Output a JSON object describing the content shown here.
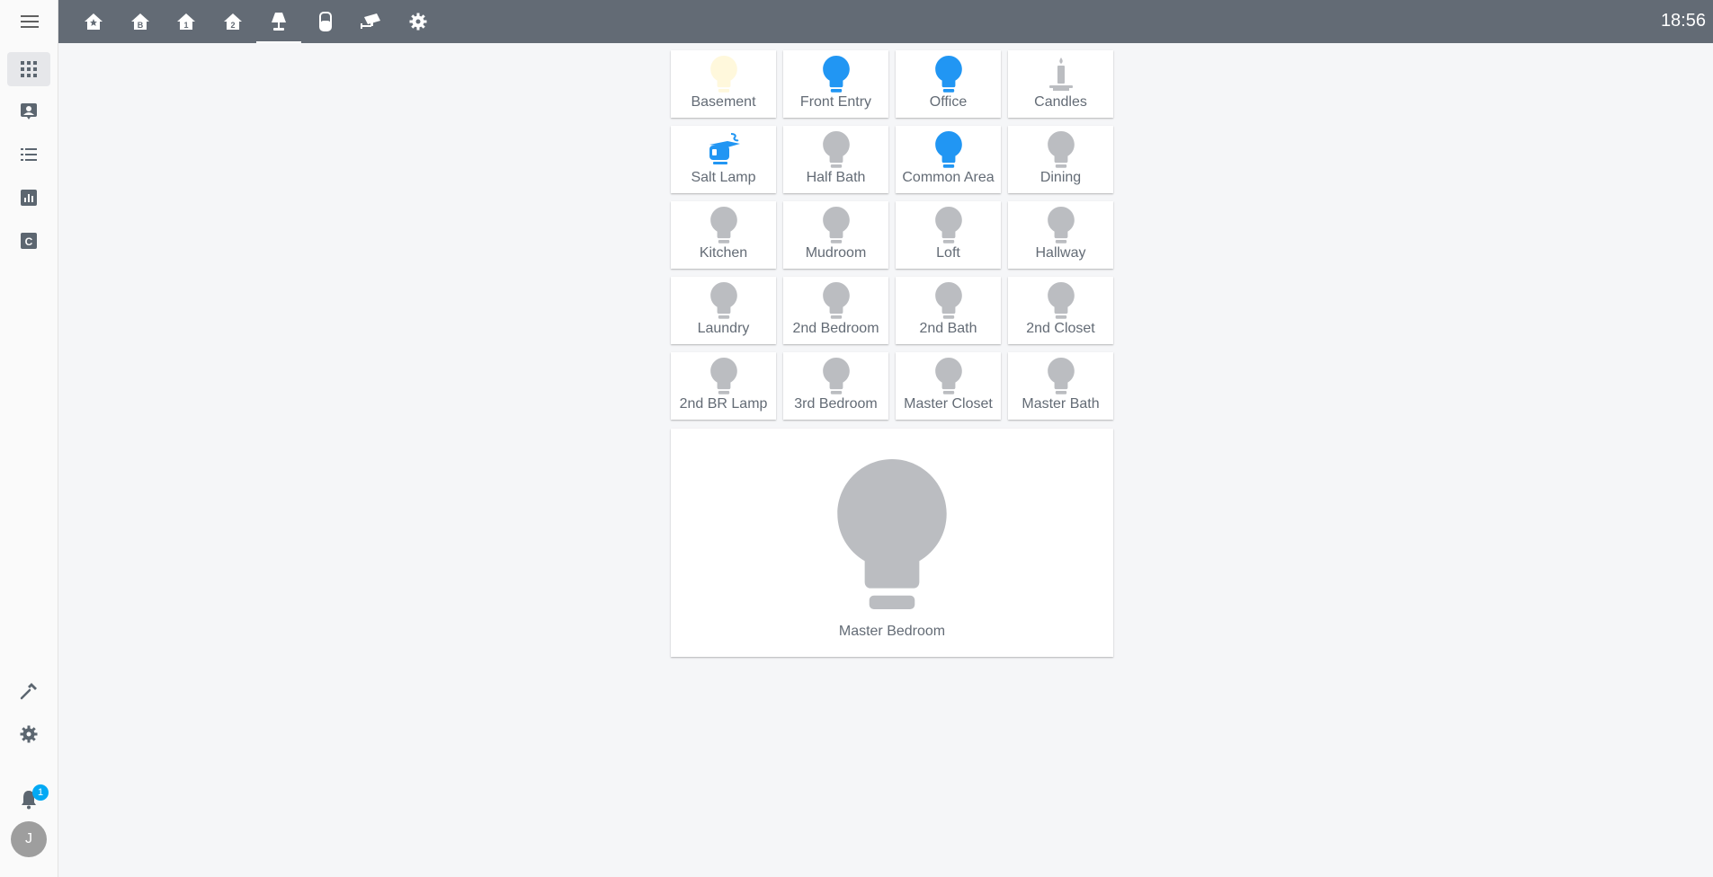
{
  "clock": "18:56",
  "colors": {
    "header": "#636b75",
    "active": "#2196f3",
    "dim": "#fff8dc",
    "off": "#bbbdc1"
  },
  "header": {
    "tabs": [
      {
        "icon": "home-star-icon"
      },
      {
        "icon": "home-floor-b-icon"
      },
      {
        "icon": "home-floor-1-icon"
      },
      {
        "icon": "home-floor-2-icon"
      },
      {
        "icon": "lamp-icon",
        "active": true
      },
      {
        "icon": "smart-speaker-icon"
      },
      {
        "icon": "cctv-icon"
      },
      {
        "icon": "gear-icon"
      }
    ]
  },
  "sidebar": {
    "items": [
      {
        "icon": "apps-grid-icon",
        "active": true
      },
      {
        "icon": "account-box-icon"
      },
      {
        "icon": "list-icon"
      },
      {
        "icon": "chart-box-icon"
      },
      {
        "icon": "letter-c-box-icon"
      }
    ],
    "bottom": [
      {
        "icon": "hammer-icon"
      },
      {
        "icon": "gear-icon"
      }
    ],
    "notification_count": "1",
    "user_initial": "J"
  },
  "lights": [
    {
      "label": "Basement",
      "state": "dim",
      "icon": "lightbulb-icon"
    },
    {
      "label": "Front Entry",
      "state": "on",
      "icon": "lightbulb-icon"
    },
    {
      "label": "Office",
      "state": "on",
      "icon": "lightbulb-icon"
    },
    {
      "label": "Candles",
      "state": "off",
      "icon": "candle-icon"
    },
    {
      "label": "Salt Lamp",
      "state": "on",
      "icon": "salt-lamp-icon"
    },
    {
      "label": "Half Bath",
      "state": "off",
      "icon": "lightbulb-icon"
    },
    {
      "label": "Common Area",
      "state": "on",
      "icon": "lightbulb-icon"
    },
    {
      "label": "Dining",
      "state": "off",
      "icon": "lightbulb-icon"
    },
    {
      "label": "Kitchen",
      "state": "off",
      "icon": "lightbulb-icon"
    },
    {
      "label": "Mudroom",
      "state": "off",
      "icon": "lightbulb-icon"
    },
    {
      "label": "Loft",
      "state": "off",
      "icon": "lightbulb-icon"
    },
    {
      "label": "Hallway",
      "state": "off",
      "icon": "lightbulb-icon"
    },
    {
      "label": "Laundry",
      "state": "off",
      "icon": "lightbulb-icon"
    },
    {
      "label": "2nd Bedroom",
      "state": "off",
      "icon": "lightbulb-icon"
    },
    {
      "label": "2nd Bath",
      "state": "off",
      "icon": "lightbulb-icon"
    },
    {
      "label": "2nd Closet",
      "state": "off",
      "icon": "lightbulb-icon"
    },
    {
      "label": "2nd BR Lamp",
      "state": "off",
      "icon": "lightbulb-icon"
    },
    {
      "label": "3rd Bedroom",
      "state": "off",
      "icon": "lightbulb-icon"
    },
    {
      "label": "Master Closet",
      "state": "off",
      "icon": "lightbulb-icon"
    },
    {
      "label": "Master Bath",
      "state": "off",
      "icon": "lightbulb-icon"
    }
  ],
  "featured": {
    "label": "Master Bedroom",
    "state": "off",
    "icon": "lightbulb-icon"
  }
}
